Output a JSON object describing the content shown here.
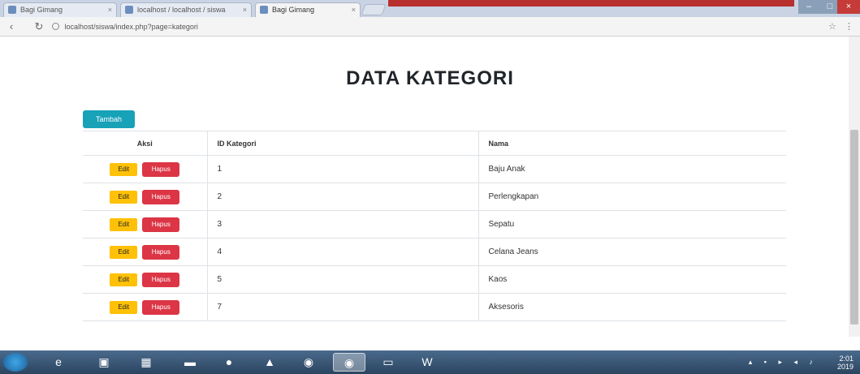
{
  "browser": {
    "tabs": [
      {
        "label": "Bagi Gimang"
      },
      {
        "label": "localhost / localhost / siswa"
      },
      {
        "label": "Bagi Gimang"
      }
    ],
    "address": "localhost/siswa/index.php?page=kategori"
  },
  "page": {
    "title": "DATA KATEGORI",
    "add_button": "Tambah",
    "table": {
      "headers": {
        "aksi": "Aksi",
        "id": "ID Kategori",
        "nama": "Nama"
      },
      "edit_label": "Edit",
      "delete_label": "Hapus",
      "rows": [
        {
          "id": "1",
          "nama": "Baju Anak"
        },
        {
          "id": "2",
          "nama": "Perlengkapan"
        },
        {
          "id": "3",
          "nama": "Sepatu"
        },
        {
          "id": "4",
          "nama": "Celana Jeans"
        },
        {
          "id": "5",
          "nama": "Kaos"
        },
        {
          "id": "7",
          "nama": "Aksesoris"
        }
      ]
    }
  },
  "taskbar": {
    "items": [
      "start-icon",
      "ie-icon",
      "explorer-icon",
      "media-icon",
      "folder-icon",
      "paint-icon",
      "app-icon",
      "chrome-icon",
      "chrome-icon",
      "window-icon",
      "word-icon"
    ],
    "clock": "2:01",
    "date": "2019"
  },
  "colors": {
    "accent_info": "#17a2b8",
    "warning": "#ffc107",
    "danger": "#dc3545"
  }
}
